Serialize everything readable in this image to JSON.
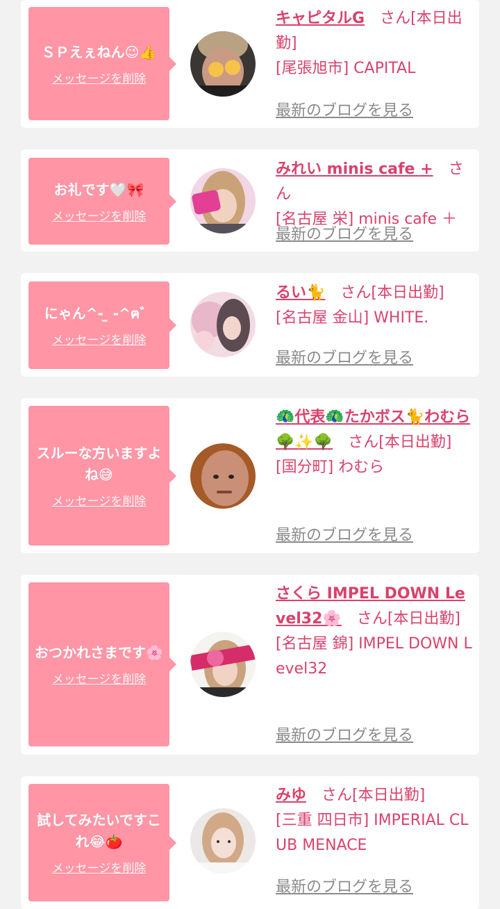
{
  "delete_label": "メッセージを削除",
  "blog_label": "最新のブログを見る",
  "san_suffix": "さん",
  "colors": {
    "bubble": "#ff95a5",
    "accent": "#d9426b",
    "muted": "#8a8a8a",
    "page_bg": "#f2f2f2"
  },
  "messages": [
    {
      "message": "ＳＰえぇねん😉👍",
      "name": "キャピタルG",
      "status": "[本日出勤]",
      "store": "[尾張旭市] CAPITAL"
    },
    {
      "message": "お礼です🤍🎀",
      "name": "みれい minis cafe +",
      "status": "",
      "store": "[名古屋 栄] minis cafe ＋"
    },
    {
      "message": "にゃん^- ̫ -^ฅ゛",
      "name": "るい🐈",
      "status": "[本日出勤]",
      "store": "[名古屋 金山] WHITE."
    },
    {
      "message": "スルーな方いますよね😅",
      "name": "🦚代表🦚たかボス🐈わむら🌳✨🌳",
      "status": "[本日出勤]",
      "store": "[国分町] わむら"
    },
    {
      "message": "おつかれさまです🌸",
      "name": "さくら IMPEL DOWN Level32🌸",
      "status": "[本日出勤]",
      "store": "[名古屋 錦] IMPEL DOWN Level32"
    },
    {
      "message": "試してみたいですこれ😂🍅",
      "name": "みゆ",
      "status": "[本日出勤]",
      "store": "[三重 四日市] IMPERIAL CLUB MENACE"
    }
  ]
}
